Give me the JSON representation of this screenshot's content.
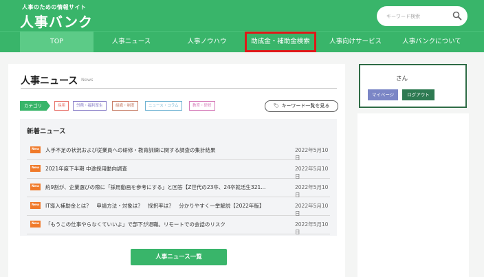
{
  "header": {
    "tagline": "人事のための情報サイト",
    "logo": "人事バンク",
    "search_placeholder": "キーワード検索"
  },
  "nav": {
    "items": [
      {
        "label": "TOP"
      },
      {
        "label": "人事ニュース"
      },
      {
        "label": "人事ノウハウ"
      },
      {
        "label": "助成金・補助金検索"
      },
      {
        "label": "人事向けサービス"
      },
      {
        "label": "人事バンクについて"
      }
    ]
  },
  "section": {
    "title": "人事ニュース",
    "subtitle": "News",
    "category_label": "カテゴリ",
    "tags": [
      {
        "label": "採用",
        "color": "#e8736b"
      },
      {
        "label": "労務・福利厚生",
        "color": "#8a7fc8"
      },
      {
        "label": "組織・制度",
        "color": "#c8806a"
      },
      {
        "label": "ニュース・コラム",
        "color": "#6fb3d2"
      },
      {
        "label": "教育・研修",
        "color": "#d57ab8"
      }
    ],
    "keyword_button": "キーワード一覧を見る"
  },
  "news": {
    "heading": "新着ニュース",
    "badge": "New",
    "items": [
      {
        "title": "人手不足の状況および従業員への研修・教育訓練に関する調査の集計結果",
        "date": "2022年5月10日"
      },
      {
        "title": "2021年度下半期 中途採用動向調査",
        "date": "2022年5月10日"
      },
      {
        "title": "約9割が、企業選びの際に「採用動画を参考にする」と回答【Z世代の23卒、24卒就活生321...",
        "date": "2022年5月10日"
      },
      {
        "title": "IT導入補助金とは？　申請方法・対象は？　採択率は？　分かりやすく一挙解説【2022年版】",
        "date": "2022年5月10日"
      },
      {
        "title": "「もうこの仕事やらなくていいよ」で部下が退職。リモートでの会話のリスク",
        "date": "2022年5月10日"
      }
    ],
    "more_button": "人事ニュース一覧"
  },
  "user": {
    "greeting": "さん",
    "mypage": "マイページ",
    "logout": "ログアウト"
  },
  "colors": {
    "brand": "#39b56a",
    "highlight": "#e01818",
    "new_badge": "#f07a2a"
  }
}
